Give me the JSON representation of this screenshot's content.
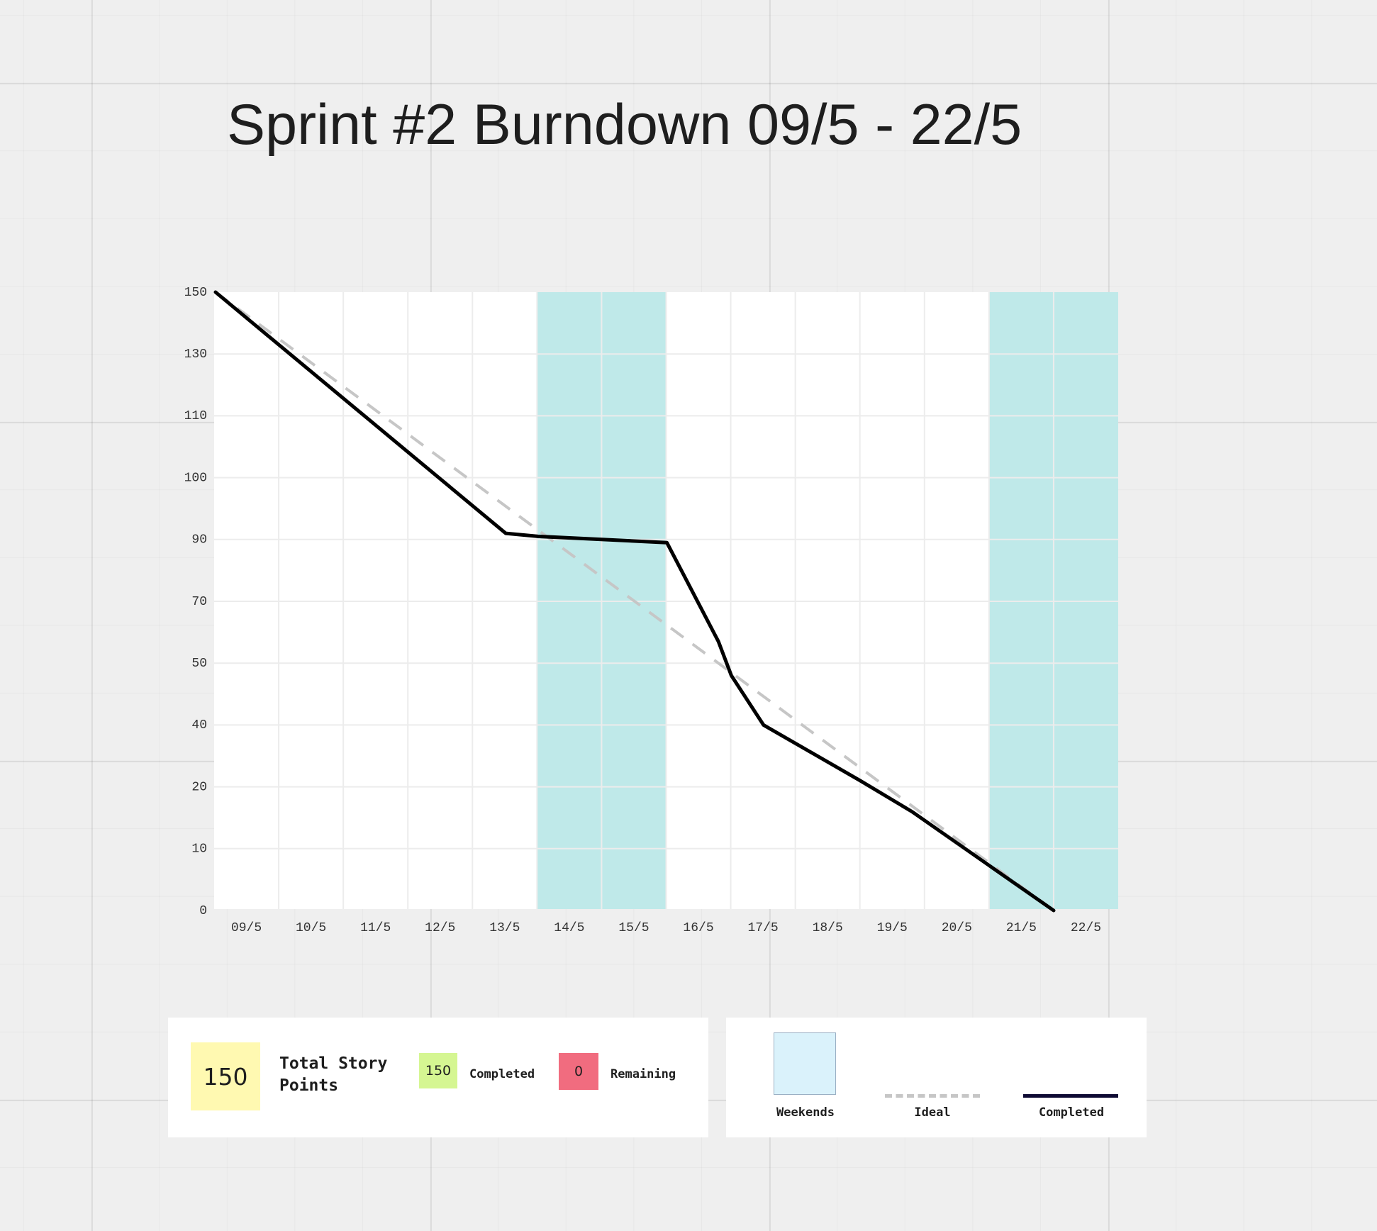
{
  "chart_data": {
    "type": "line",
    "title": "Sprint #2 Burndown 09/5 - 22/5",
    "categories": [
      "09/5",
      "10/5",
      "11/5",
      "12/5",
      "13/5",
      "14/5",
      "15/5",
      "16/5",
      "17/5",
      "18/5",
      "19/5",
      "20/5",
      "21/5",
      "22/5"
    ],
    "y_ticks": [
      150,
      130,
      110,
      100,
      90,
      70,
      50,
      40,
      20,
      10,
      0
    ],
    "ylim": [
      0,
      150
    ],
    "weekends": [
      "14/5",
      "15/5",
      "21/5",
      "22/5"
    ],
    "series": [
      {
        "name": "Ideal",
        "style": "dashed",
        "color": "#c6c6c6",
        "points": [
          [
            0,
            150
          ],
          [
            13,
            0
          ]
        ]
      },
      {
        "name": "Completed",
        "style": "solid",
        "color": "#000000",
        "points": [
          [
            0,
            150
          ],
          [
            4.5,
            91
          ],
          [
            5,
            90.5
          ],
          [
            7,
            89
          ],
          [
            7.8,
            57
          ],
          [
            8,
            48
          ],
          [
            8.5,
            40
          ],
          [
            10,
            22
          ],
          [
            10.8,
            16
          ],
          [
            13,
            0
          ]
        ]
      }
    ],
    "colors": {
      "weekend_band": "#bfe9e9",
      "plot_background": "#ffffff",
      "grid": "#ececec"
    },
    "grid": true
  },
  "summary": {
    "total_value": "150",
    "total_label": "Total Story Points",
    "completed_value": "150",
    "completed_label": "Completed",
    "remaining_value": "0",
    "remaining_label": "Remaining",
    "colors": {
      "total_sticky": "#fff9b1",
      "completed_sticky": "#d5f692",
      "remaining_sticky": "#f16c7f"
    }
  },
  "legend": {
    "weekends_label": "Weekends",
    "ideal_label": "Ideal",
    "completed_label": "Completed"
  }
}
